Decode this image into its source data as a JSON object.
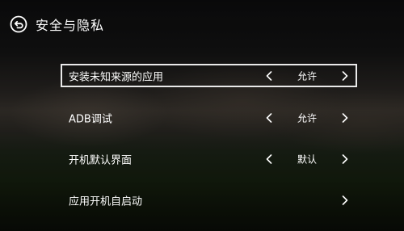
{
  "header": {
    "title": "安全与隐私",
    "back_icon": "back-arrow-circle-icon"
  },
  "menu": {
    "items": [
      {
        "label": "安装未知来源的应用",
        "value": "允许",
        "has_left_arrow": true,
        "has_right_arrow": true,
        "focused": true
      },
      {
        "label": "ADB调试",
        "value": "允许",
        "has_left_arrow": true,
        "has_right_arrow": true,
        "focused": false
      },
      {
        "label": "开机默认界面",
        "value": "默认",
        "has_left_arrow": true,
        "has_right_arrow": true,
        "focused": false
      },
      {
        "label": "应用开机自启动",
        "value": "",
        "has_left_arrow": false,
        "has_right_arrow": true,
        "focused": false
      }
    ]
  },
  "colors": {
    "focus_border": "#e9e9e9",
    "text": "#ffffff"
  }
}
